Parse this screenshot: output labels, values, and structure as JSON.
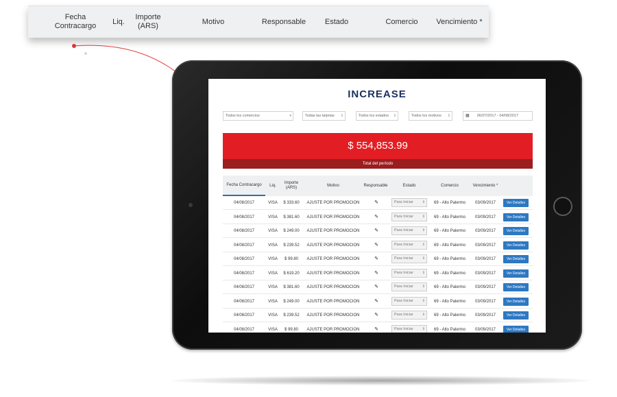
{
  "zoom_header": {
    "fecha": "Fecha Contracargo",
    "liq": "Liq.",
    "importe": "Importe\n(ARS)",
    "motivo": "Motivo",
    "responsable": "Responsable",
    "estado": "Estado",
    "comercio": "Comercio",
    "vencimiento": "Vencimiento *"
  },
  "app": {
    "logo": "INCREASE",
    "filters": {
      "comercios": "Todos los comercios",
      "tarjetas": "Todas las tarjetas",
      "estados": "Todos los estados",
      "motivos": "Todos los motivos",
      "fechas": "06/07/2017 - 04/08/2017"
    },
    "total": "$ 554,853.99",
    "total_label": "Total del período",
    "columns": {
      "fecha": "Fecha Contracargo",
      "liq": "Liq.",
      "importe": "Importe (ARS)",
      "motivo": "Motivo",
      "responsable": "Responsable",
      "estado": "Estado",
      "comercio": "Comercio",
      "vencimiento": "Vencimiento *"
    },
    "rows": [
      {
        "fecha": "04/08/2017",
        "liq": "VISA",
        "importe": "$ 333.60",
        "motivo": "AJUSTE POR PROMOCION",
        "estado": "Para Iniciar",
        "comercio": "69 - Alto Palermo",
        "vencimiento": "03/09/2017",
        "accion": "Ver Detalles"
      },
      {
        "fecha": "04/08/2017",
        "liq": "VISA",
        "importe": "$ 381.60",
        "motivo": "AJUSTE POR PROMOCION",
        "estado": "Para Iniciar",
        "comercio": "69 - Alto Palermo",
        "vencimiento": "03/09/2017",
        "accion": "Ver Detalles"
      },
      {
        "fecha": "04/08/2017",
        "liq": "VISA",
        "importe": "$ 249.00",
        "motivo": "AJUSTE POR PROMOCION",
        "estado": "Para Iniciar",
        "comercio": "69 - Alto Palermo",
        "vencimiento": "03/09/2017",
        "accion": "Ver Detalles"
      },
      {
        "fecha": "04/08/2017",
        "liq": "VISA",
        "importe": "$ 239.52",
        "motivo": "AJUSTE POR PROMOCION",
        "estado": "Para Iniciar",
        "comercio": "69 - Alto Palermo",
        "vencimiento": "03/09/2017",
        "accion": "Ver Detalles"
      },
      {
        "fecha": "04/08/2017",
        "liq": "VISA",
        "importe": "$ 99.80",
        "motivo": "AJUSTE POR PROMOCION",
        "estado": "Para Iniciar",
        "comercio": "69 - Alto Palermo",
        "vencimiento": "03/09/2017",
        "accion": "Ver Detalles"
      },
      {
        "fecha": "04/08/2017",
        "liq": "VISA",
        "importe": "$ 619.20",
        "motivo": "AJUSTE POR PROMOCION",
        "estado": "Para Iniciar",
        "comercio": "69 - Alto Palermo",
        "vencimiento": "03/09/2017",
        "accion": "Ver Detalles"
      },
      {
        "fecha": "04/08/2017",
        "liq": "VISA",
        "importe": "$ 381.60",
        "motivo": "AJUSTE POR PROMOCION",
        "estado": "Para Iniciar",
        "comercio": "69 - Alto Palermo",
        "vencimiento": "03/09/2017",
        "accion": "Ver Detalles"
      },
      {
        "fecha": "04/08/2017",
        "liq": "VISA",
        "importe": "$ 249.00",
        "motivo": "AJUSTE POR PROMOCION",
        "estado": "Para Iniciar",
        "comercio": "69 - Alto Palermo",
        "vencimiento": "03/09/2017",
        "accion": "Ver Detalles"
      },
      {
        "fecha": "04/08/2017",
        "liq": "VISA",
        "importe": "$ 239.52",
        "motivo": "AJUSTE POR PROMOCION",
        "estado": "Para Iniciar",
        "comercio": "69 - Alto Palermo",
        "vencimiento": "03/09/2017",
        "accion": "Ver Detalles"
      },
      {
        "fecha": "04/08/2017",
        "liq": "VISA",
        "importe": "$ 99.80",
        "motivo": "AJUSTE POR PROMOCION",
        "estado": "Para Iniciar",
        "comercio": "69 - Alto Palermo",
        "vencimiento": "03/09/2017",
        "accion": "Ver Detalles"
      }
    ]
  },
  "colors": {
    "accent_red": "#e21e24",
    "dark_red": "#9b1d1d",
    "button_blue": "#2d78c2",
    "logo_navy": "#1c2f5e"
  },
  "icons": {
    "edit": "pencil-icon",
    "calendar": "calendar-icon",
    "dropdown": "chevron-down-icon"
  }
}
